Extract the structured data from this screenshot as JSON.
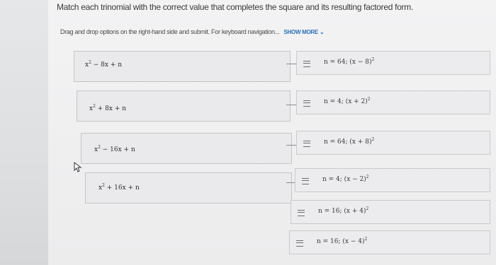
{
  "header": {
    "title": "Match each trinomial with the correct value that completes the square and its resulting factored form.",
    "instructions": "Drag and drop options on the right-hand side and submit. For keyboard navigation...",
    "show_more": "SHOW MORE"
  },
  "trinomials": [
    {
      "base": "x",
      "sup": "2",
      "rest": " − 8x + n"
    },
    {
      "base": "x",
      "sup": "2",
      "rest": " + 8x + n"
    },
    {
      "base": "x",
      "sup": "2",
      "rest": " − 16x + n"
    },
    {
      "base": "x",
      "sup": "2",
      "rest": " + 16x + n"
    }
  ],
  "options": [
    {
      "text": "n = 64; (x − 8)",
      "sup": "2"
    },
    {
      "text": "n = 4; (x + 2)",
      "sup": "2"
    },
    {
      "text": "n = 64; (x + 8)",
      "sup": "2"
    },
    {
      "text": "n = 4; (x − 2)",
      "sup": "2"
    },
    {
      "text": "n = 16; (x + 4)",
      "sup": "2"
    },
    {
      "text": "n = 16; (x − 4)",
      "sup": "2"
    }
  ]
}
